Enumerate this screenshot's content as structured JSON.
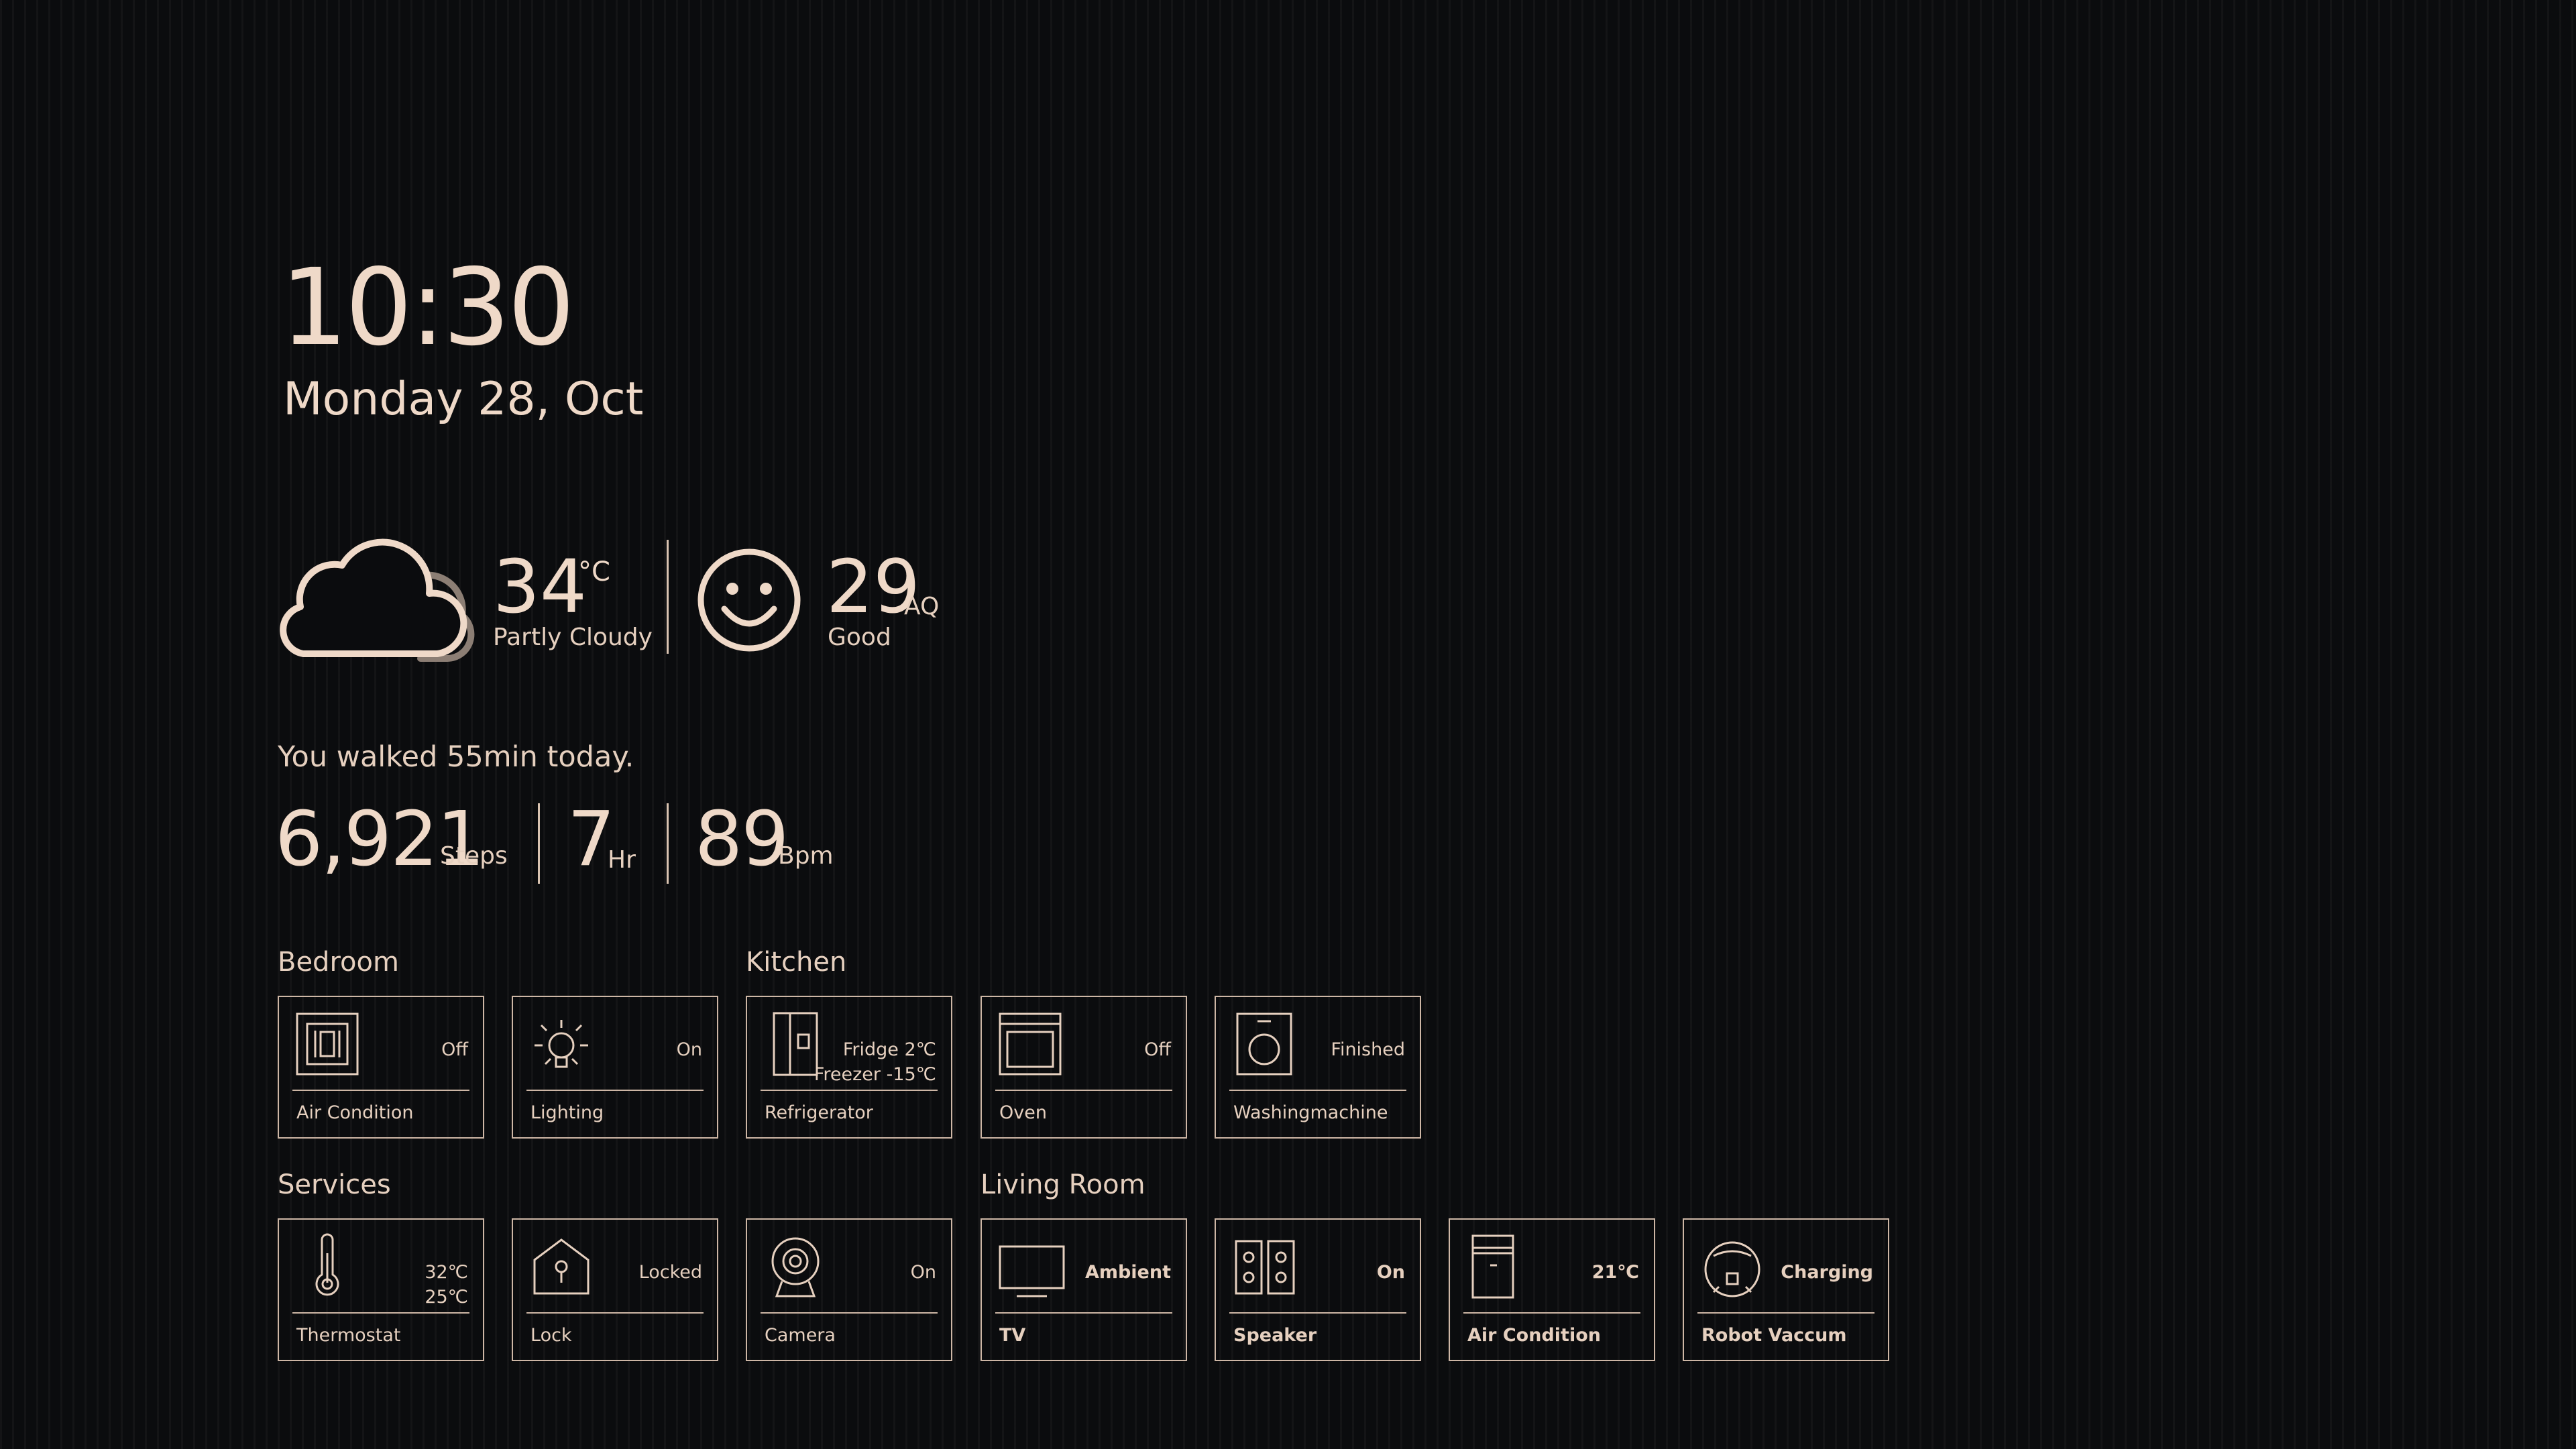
{
  "time": "10:30",
  "date": "Monday 28, Oct",
  "weather": {
    "temp": "34",
    "temp_unit": "°C",
    "condition": "Partly Cloudy",
    "icon": "partly-cloudy-icon"
  },
  "air": {
    "value": "29",
    "unit": "AQ",
    "status": "Good",
    "icon": "smiley-icon"
  },
  "activity": {
    "message": "You walked 55min today.",
    "steps": "6,921",
    "steps_unit": "Steps",
    "hours": "7",
    "hours_unit": "Hr",
    "bpm": "89",
    "bpm_unit": "Bpm"
  },
  "colors": {
    "background": "#0b0c0e",
    "accent": "#e9d4c4",
    "border": "#cdb6a5"
  },
  "sections": {
    "bedroom": {
      "title": "Bedroom",
      "devices": [
        {
          "name": "Air Condition",
          "status": "Off",
          "icon": "air-conditioner-icon"
        },
        {
          "name": "Lighting",
          "status": "On",
          "icon": "light-bulb-icon"
        }
      ]
    },
    "kitchen": {
      "title": "Kitchen",
      "devices": [
        {
          "name": "Refrigerator",
          "status": "Fridge 2℃",
          "status2": "Freezer -15℃",
          "icon": "refrigerator-icon"
        },
        {
          "name": "Oven",
          "status": "Off",
          "icon": "oven-icon"
        },
        {
          "name": "Washingmachine",
          "status": "Finished",
          "icon": "washing-machine-icon"
        }
      ]
    },
    "services": {
      "title": "Services",
      "devices": [
        {
          "name": "Thermostat",
          "status": "32℃",
          "status2": "25℃",
          "icon": "thermometer-icon"
        },
        {
          "name": "Lock",
          "status": "Locked",
          "icon": "house-lock-icon"
        },
        {
          "name": "Camera",
          "status": "On",
          "icon": "camera-icon"
        }
      ]
    },
    "living_room": {
      "title": "Living Room",
      "devices": [
        {
          "name": "TV",
          "status": "Ambient",
          "icon": "tv-icon"
        },
        {
          "name": "Speaker",
          "status": "On",
          "icon": "speaker-icon"
        },
        {
          "name": "Air Condition",
          "status": "21℃",
          "icon": "air-purifier-icon"
        },
        {
          "name": "Robot Vaccum",
          "status": "Charging",
          "icon": "robot-vacuum-icon"
        }
      ]
    }
  }
}
